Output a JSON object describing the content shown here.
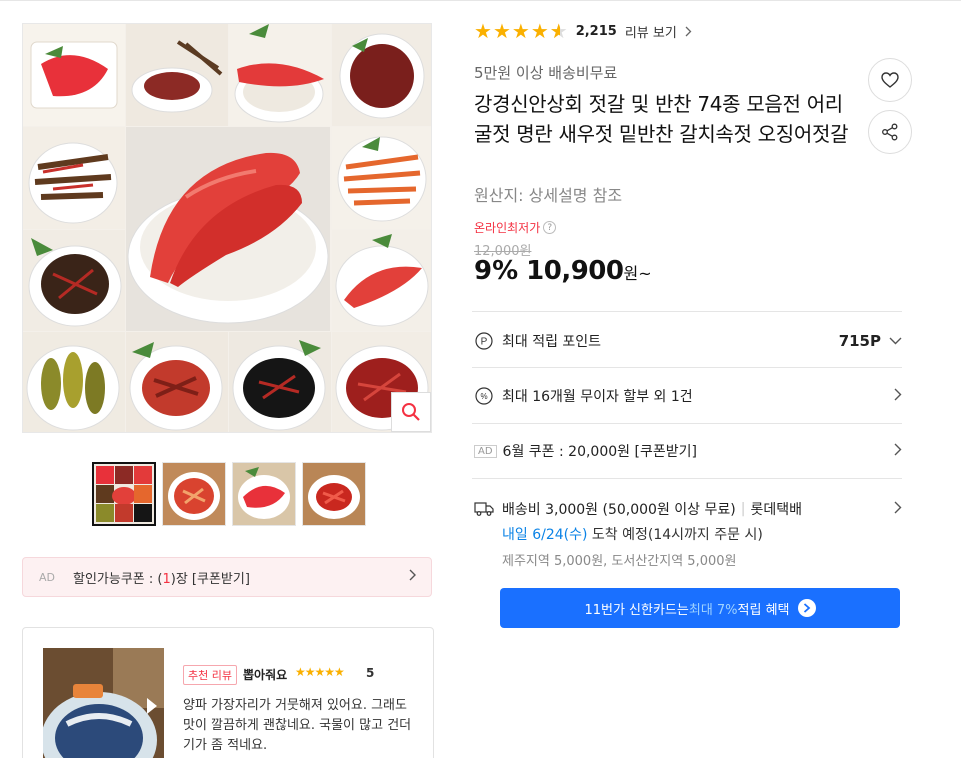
{
  "rating": {
    "stars": 4.5,
    "count": "2,215",
    "link_label": "리뷰 보기"
  },
  "product": {
    "shipping_badge": "5만원 이상 배송비무료",
    "title": "강경신안상회 젓갈 및 반찬 74종 모음전 어리굴젓 명란 새우젓 밑반찬 갈치속젓 오징어젓갈",
    "origin": "원산지:  상세설명 참조",
    "lowest_price_label": "온라인최저가",
    "original_price": "12,000원",
    "discount": "9%",
    "price": "10,900",
    "price_unit": "원~"
  },
  "benefits": {
    "points_label": "최대 적립 포인트",
    "points_value": "715P",
    "installment_label": "최대 16개월 무이자 할부 외 1건",
    "ad_tag": "AD",
    "coupon_label": "6월 쿠폰 : 20,000원 [쿠폰받기]"
  },
  "shipping": {
    "fee": "배송비 3,000원 (50,000원 이상 무료)",
    "courier": "롯데택배",
    "arrival_date": "내일 6/24(수)",
    "arrival_suffix": " 도착 예정(14시까지 주문 시)",
    "extra_fee": "제주지역 5,000원, 도서산간지역 5,000원"
  },
  "card_banner": {
    "prefix": "11번가 신한카드는 ",
    "highlight": "최대 7%",
    "suffix": " 적립 혜택"
  },
  "coupon_bar": {
    "ad": "AD",
    "prefix": "할인가능쿠폰 : (",
    "count": "1",
    "suffix": ")장 [쿠폰받기]"
  },
  "review": {
    "badge": "추천 리뷰",
    "user": "뽑아줘요",
    "stars": "★★★★★",
    "score": "5",
    "text": "양파 가장자리가 거뭇해져 있어요. 그래도 맛이 깔끔하게 괜찮네요. 국물이 많고 건더기가 좀 적네요.",
    "image_count": "2"
  },
  "colors": {
    "accent_red": "#f43142",
    "star": "#fab000",
    "link_blue": "#0b83e6",
    "banner_blue": "#1a70ff"
  }
}
